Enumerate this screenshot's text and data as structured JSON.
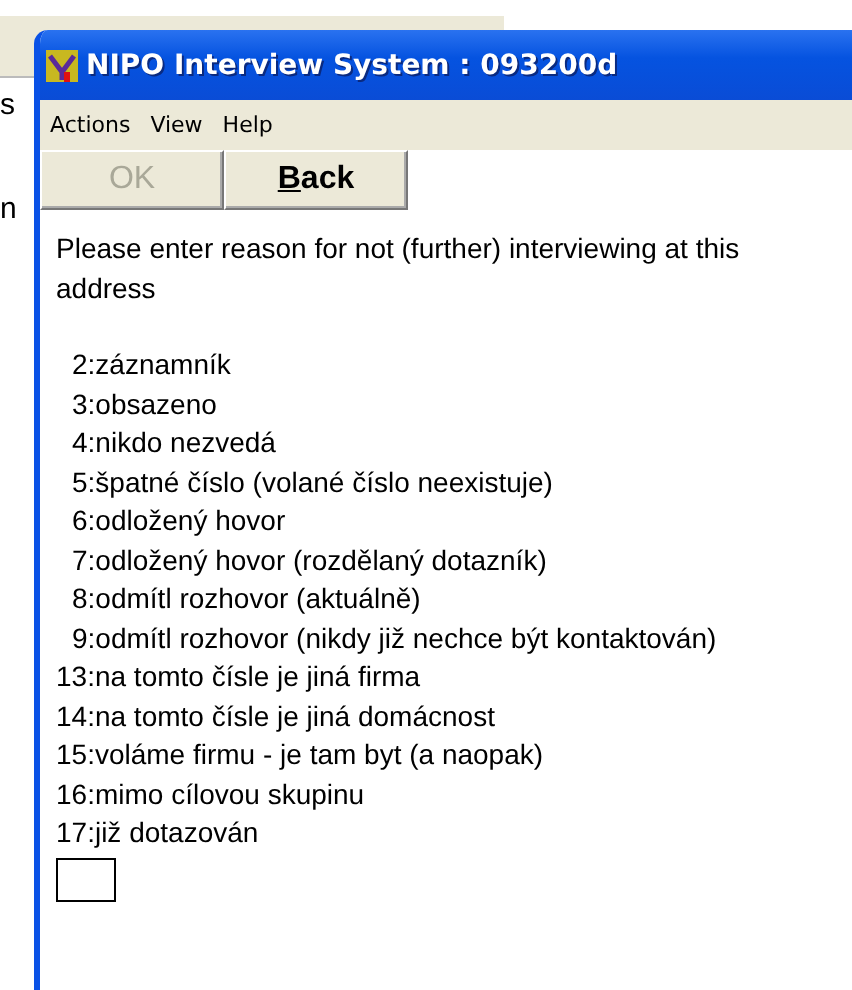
{
  "background_window": {
    "fragments": [
      "s",
      "n"
    ]
  },
  "window": {
    "title": "NIPO Interview System : 093200d"
  },
  "menu": [
    "Actions",
    "View",
    "Help"
  ],
  "buttons": [
    {
      "label": "OK",
      "disabled": true,
      "mnemonic": false
    },
    {
      "label": "Back",
      "disabled": false,
      "mnemonic": true
    }
  ],
  "question": "Please enter reason for not (further) interviewing at this address",
  "options": [
    {
      "text": "2:záznamník",
      "indented": true
    },
    {
      "text": "3:obsazeno",
      "indented": true
    },
    {
      "text": "4:nikdo nezvedá",
      "indented": true
    },
    {
      "text": "5:špatné číslo (volané číslo neexistuje)",
      "indented": true
    },
    {
      "text": "6:odložený hovor",
      "indented": true
    },
    {
      "text": "7:odložený hovor (rozdělaný dotazník)",
      "indented": true
    },
    {
      "text": "8:odmítl rozhovor (aktuálně)",
      "indented": true
    },
    {
      "text": "9:odmítl rozhovor (nikdy již nechce být kontaktován)",
      "indented": true
    },
    {
      "text": "13:na tomto čísle je jiná firma",
      "indented": false
    },
    {
      "text": "14:na tomto čísle je jiná domácnost",
      "indented": false
    },
    {
      "text": "15:voláme firmu - je tam byt (a naopak)",
      "indented": false
    },
    {
      "text": "16:mimo cílovou skupinu",
      "indented": false
    },
    {
      "text": "17:již dotazován",
      "indented": false
    }
  ]
}
